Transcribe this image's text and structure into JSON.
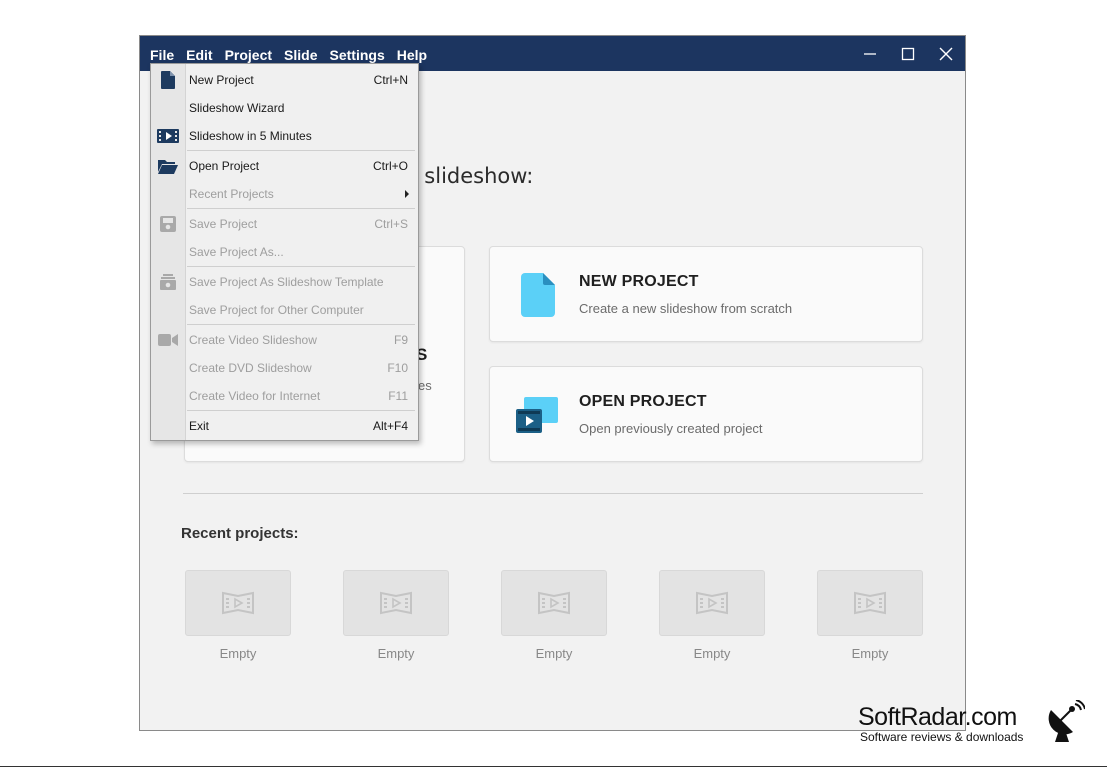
{
  "menubar": [
    "File",
    "Edit",
    "Project",
    "Slide",
    "Settings",
    "Help"
  ],
  "window_controls": [
    "minimize-icon",
    "maximize-icon",
    "close-icon"
  ],
  "welcome": {
    "heading_visible": "r slideshow:",
    "left_card_partial_title": "S",
    "left_card_partial_desc": "es"
  },
  "new_project": {
    "title": "NEW PROJECT",
    "desc": "Create a new slideshow from scratch",
    "icon": "file-icon",
    "icon_color": "#4fc3f0"
  },
  "open_project": {
    "title": "OPEN PROJECT",
    "desc": "Open previously created project",
    "icon": "video-folder-icon",
    "icon_color": "#1e7fb0"
  },
  "recent": {
    "heading": "Recent projects:",
    "items": [
      {
        "label": "Empty"
      },
      {
        "label": "Empty"
      },
      {
        "label": "Empty"
      },
      {
        "label": "Empty"
      },
      {
        "label": "Empty"
      }
    ]
  },
  "file_menu": {
    "items": [
      {
        "label": "New Project",
        "shortcut": "Ctrl+N",
        "enabled": true,
        "icon": "new-file-icon"
      },
      {
        "label": "Slideshow Wizard",
        "shortcut": "",
        "enabled": true,
        "icon": ""
      },
      {
        "label": "Slideshow in 5 Minutes",
        "shortcut": "",
        "enabled": true,
        "icon": "film-icon"
      },
      {
        "label": "Open Project",
        "shortcut": "Ctrl+O",
        "enabled": true,
        "icon": "folder-icon"
      },
      {
        "label": "Recent Projects",
        "shortcut": "",
        "enabled": false,
        "icon": "",
        "submenu": true
      },
      {
        "label": "Save Project",
        "shortcut": "Ctrl+S",
        "enabled": false,
        "icon": "save-icon"
      },
      {
        "label": "Save Project As...",
        "shortcut": "",
        "enabled": false,
        "icon": ""
      },
      {
        "label": "Save Project As Slideshow Template",
        "shortcut": "",
        "enabled": false,
        "icon": "template-icon"
      },
      {
        "label": "Save Project for Other Computer",
        "shortcut": "",
        "enabled": false,
        "icon": ""
      },
      {
        "label": "Create Video Slideshow",
        "shortcut": "F9",
        "enabled": false,
        "icon": "camera-icon"
      },
      {
        "label": "Create DVD Slideshow",
        "shortcut": "F10",
        "enabled": false,
        "icon": ""
      },
      {
        "label": "Create Video for Internet",
        "shortcut": "F11",
        "enabled": false,
        "icon": ""
      },
      {
        "label": "Exit",
        "shortcut": "Alt+F4",
        "enabled": true,
        "icon": ""
      }
    ]
  },
  "watermark": {
    "title": "SoftRadar.com",
    "subtitle": "Software reviews & downloads"
  },
  "colors": {
    "titlebar": "#1c3560",
    "background": "#f2f2f2",
    "accent": "#4fc3f0"
  }
}
